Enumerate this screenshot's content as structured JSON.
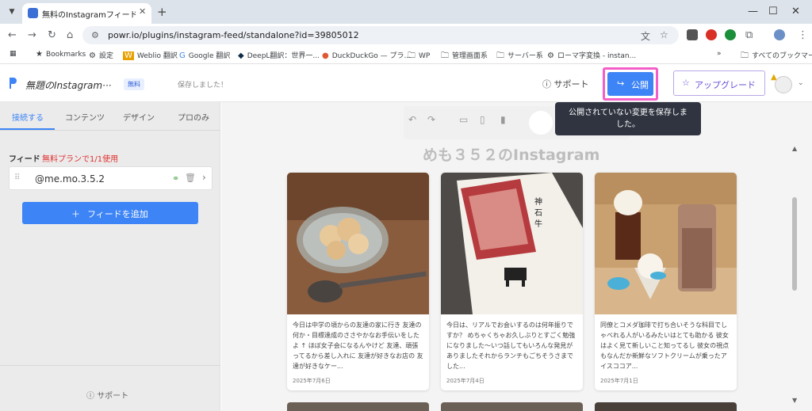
{
  "browser": {
    "tab_title": "無料のInstagramフィードソフトウェ",
    "url": "powr.io/plugins/instagram-feed/standalone?id=39805012",
    "bookmarks": [
      {
        "label": "Bookmarks",
        "icon": "star-icon"
      },
      {
        "label": "設定",
        "icon": "gear-icon"
      },
      {
        "label": "Weblio 翻訳",
        "icon": "weblio-icon"
      },
      {
        "label": "Google 翻訳",
        "icon": "translate-icon"
      },
      {
        "label": "DeepL翻訳：世界一...",
        "icon": "deepl-icon"
      },
      {
        "label": "DuckDuckGo — プラ...",
        "icon": "duckduckgo-icon"
      },
      {
        "label": "WP",
        "icon": "folder-icon"
      },
      {
        "label": "管理画面系",
        "icon": "folder-icon"
      },
      {
        "label": "サーバー系",
        "icon": "folder-icon"
      },
      {
        "label": "ローマ字変換 - instan...",
        "icon": "kana-icon"
      },
      {
        "label": "すべてのブックマーク",
        "icon": "folder-icon"
      }
    ]
  },
  "header": {
    "title": "無題のInstagram···",
    "badge": "無料",
    "save_status": "保存しました！",
    "support": "サポート",
    "publish": "公開",
    "upgrade": "アップグレード"
  },
  "sidebar": {
    "tabs": [
      "接続する",
      "コンテンツ",
      "デザイン",
      "プロのみ"
    ],
    "feed_label": "フィード",
    "feed_usage": "無料プランで1/1使用",
    "feed_handle": "@me.mo.3.5.2",
    "add_feed": "フィードを追加",
    "support": "サポート"
  },
  "preview": {
    "tooltip_line1": "公開されていない変更を保存しま",
    "tooltip_line2": "した。",
    "feed_title": "めも３５２のInstagram",
    "posts": [
      {
        "caption": "今日は中学の頃からの友達の家に行き 友達の何か・目標達成のささやかなお手伝いをしたよ ↑ ほぼ女子会になるんやけど 友達、頑張ってるから差し入れに 友達が好きなお店の 友達が好きなケー...",
        "date": "2025年7月6日"
      },
      {
        "caption": "今日は、リアルでお会いするのは何年振りですか？ めちゃくちゃお久しぶりとすごく勉強になりました〜いつ話してもいろんな発見がありましたそれからランチもごちそうさまでした...",
        "date": "2025年7月4日"
      },
      {
        "caption": "同僚とコメダ珈琲で打ち合いそうな科目でしゃべれる人がいるみたいはとても助かる 彼女はよく見て新しいこと知ってるし 彼女の視点もなんだか新鮮なソフトクリームが乗ったアイスココア...",
        "date": "2025年7月1日"
      }
    ]
  }
}
